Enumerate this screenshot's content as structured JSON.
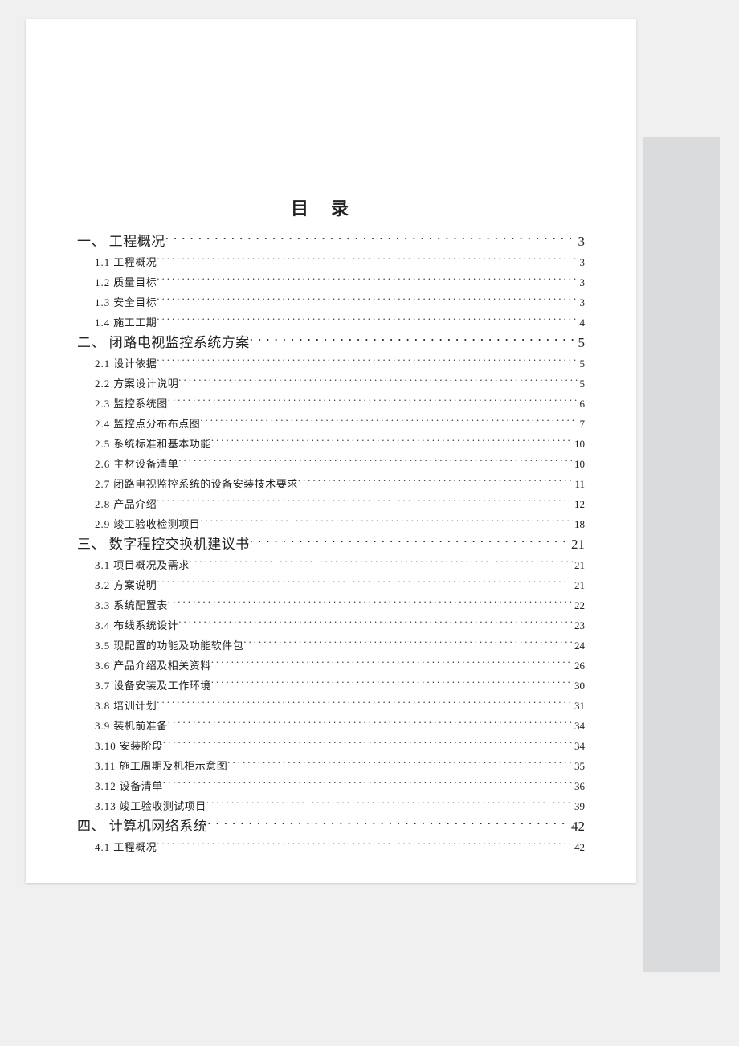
{
  "title": "目录",
  "toc": [
    {
      "level": 1,
      "num": "一、",
      "label": "工程概况",
      "page": "3"
    },
    {
      "level": 2,
      "num": "1.1",
      "label": "工程概况",
      "page": "3"
    },
    {
      "level": 2,
      "num": "1.2",
      "label": "质量目标",
      "page": "3"
    },
    {
      "level": 2,
      "num": "1.3",
      "label": "安全目标",
      "page": "3"
    },
    {
      "level": 2,
      "num": "1.4",
      "label": "施工工期",
      "page": "4"
    },
    {
      "level": 1,
      "num": "二、",
      "label": "闭路电视监控系统方案",
      "page": "5"
    },
    {
      "level": 2,
      "num": "2.1",
      "label": "设计依据",
      "page": "5"
    },
    {
      "level": 2,
      "num": "2.2",
      "label": "方案设计说明",
      "page": "5"
    },
    {
      "level": 2,
      "num": "2.3",
      "label": "监控系统图",
      "page": "6"
    },
    {
      "level": 2,
      "num": "2.4",
      "label": "监控点分布布点图",
      "page": "7"
    },
    {
      "level": 2,
      "num": "2.5",
      "label": "系统标准和基本功能",
      "page": "10"
    },
    {
      "level": 2,
      "num": "2.6",
      "label": "主材设备清单",
      "page": "10"
    },
    {
      "level": 2,
      "num": "2.7",
      "label": "闭路电视监控系统的设备安装技术要求",
      "page": "11"
    },
    {
      "level": 2,
      "num": "2.8",
      "label": "产品介绍",
      "page": "12"
    },
    {
      "level": 2,
      "num": "2.9",
      "label": "竣工验收检测项目",
      "page": "18"
    },
    {
      "level": 1,
      "num": "三、",
      "label": "数字程控交换机建议书",
      "page": "21"
    },
    {
      "level": 2,
      "num": "3.1",
      "label": "项目概况及需求",
      "page": "21"
    },
    {
      "level": 2,
      "num": "3.2",
      "label": "方案说明",
      "page": "21"
    },
    {
      "level": 2,
      "num": "3.3",
      "label": "系统配置表",
      "page": "22"
    },
    {
      "level": 2,
      "num": "3.4",
      "label": "布线系统设计",
      "page": "23"
    },
    {
      "level": 2,
      "num": "3.5",
      "label": "现配置的功能及功能软件包",
      "page": "24"
    },
    {
      "level": 2,
      "num": "3.6",
      "label": "产品介绍及相关资料",
      "page": "26"
    },
    {
      "level": 2,
      "num": "3.7",
      "label": "设备安装及工作环境",
      "page": "30"
    },
    {
      "level": 2,
      "num": "3.8",
      "label": "培训计划",
      "page": "31"
    },
    {
      "level": 2,
      "num": "3.9",
      "label": "装机前准备",
      "page": "34"
    },
    {
      "level": 2,
      "num": "3.10",
      "label": "安装阶段",
      "page": "34"
    },
    {
      "level": 2,
      "num": "3.11",
      "label": "施工周期及机柜示意图",
      "page": "35"
    },
    {
      "level": 2,
      "num": "3.12",
      "label": "设备清单",
      "page": "36"
    },
    {
      "level": 2,
      "num": "3.13",
      "label": "竣工验收测试项目",
      "page": "39"
    },
    {
      "level": 1,
      "num": "四、",
      "label": "计算机网络系统",
      "page": "42"
    },
    {
      "level": 2,
      "num": "4.1",
      "label": "工程概况",
      "page": "42"
    }
  ]
}
